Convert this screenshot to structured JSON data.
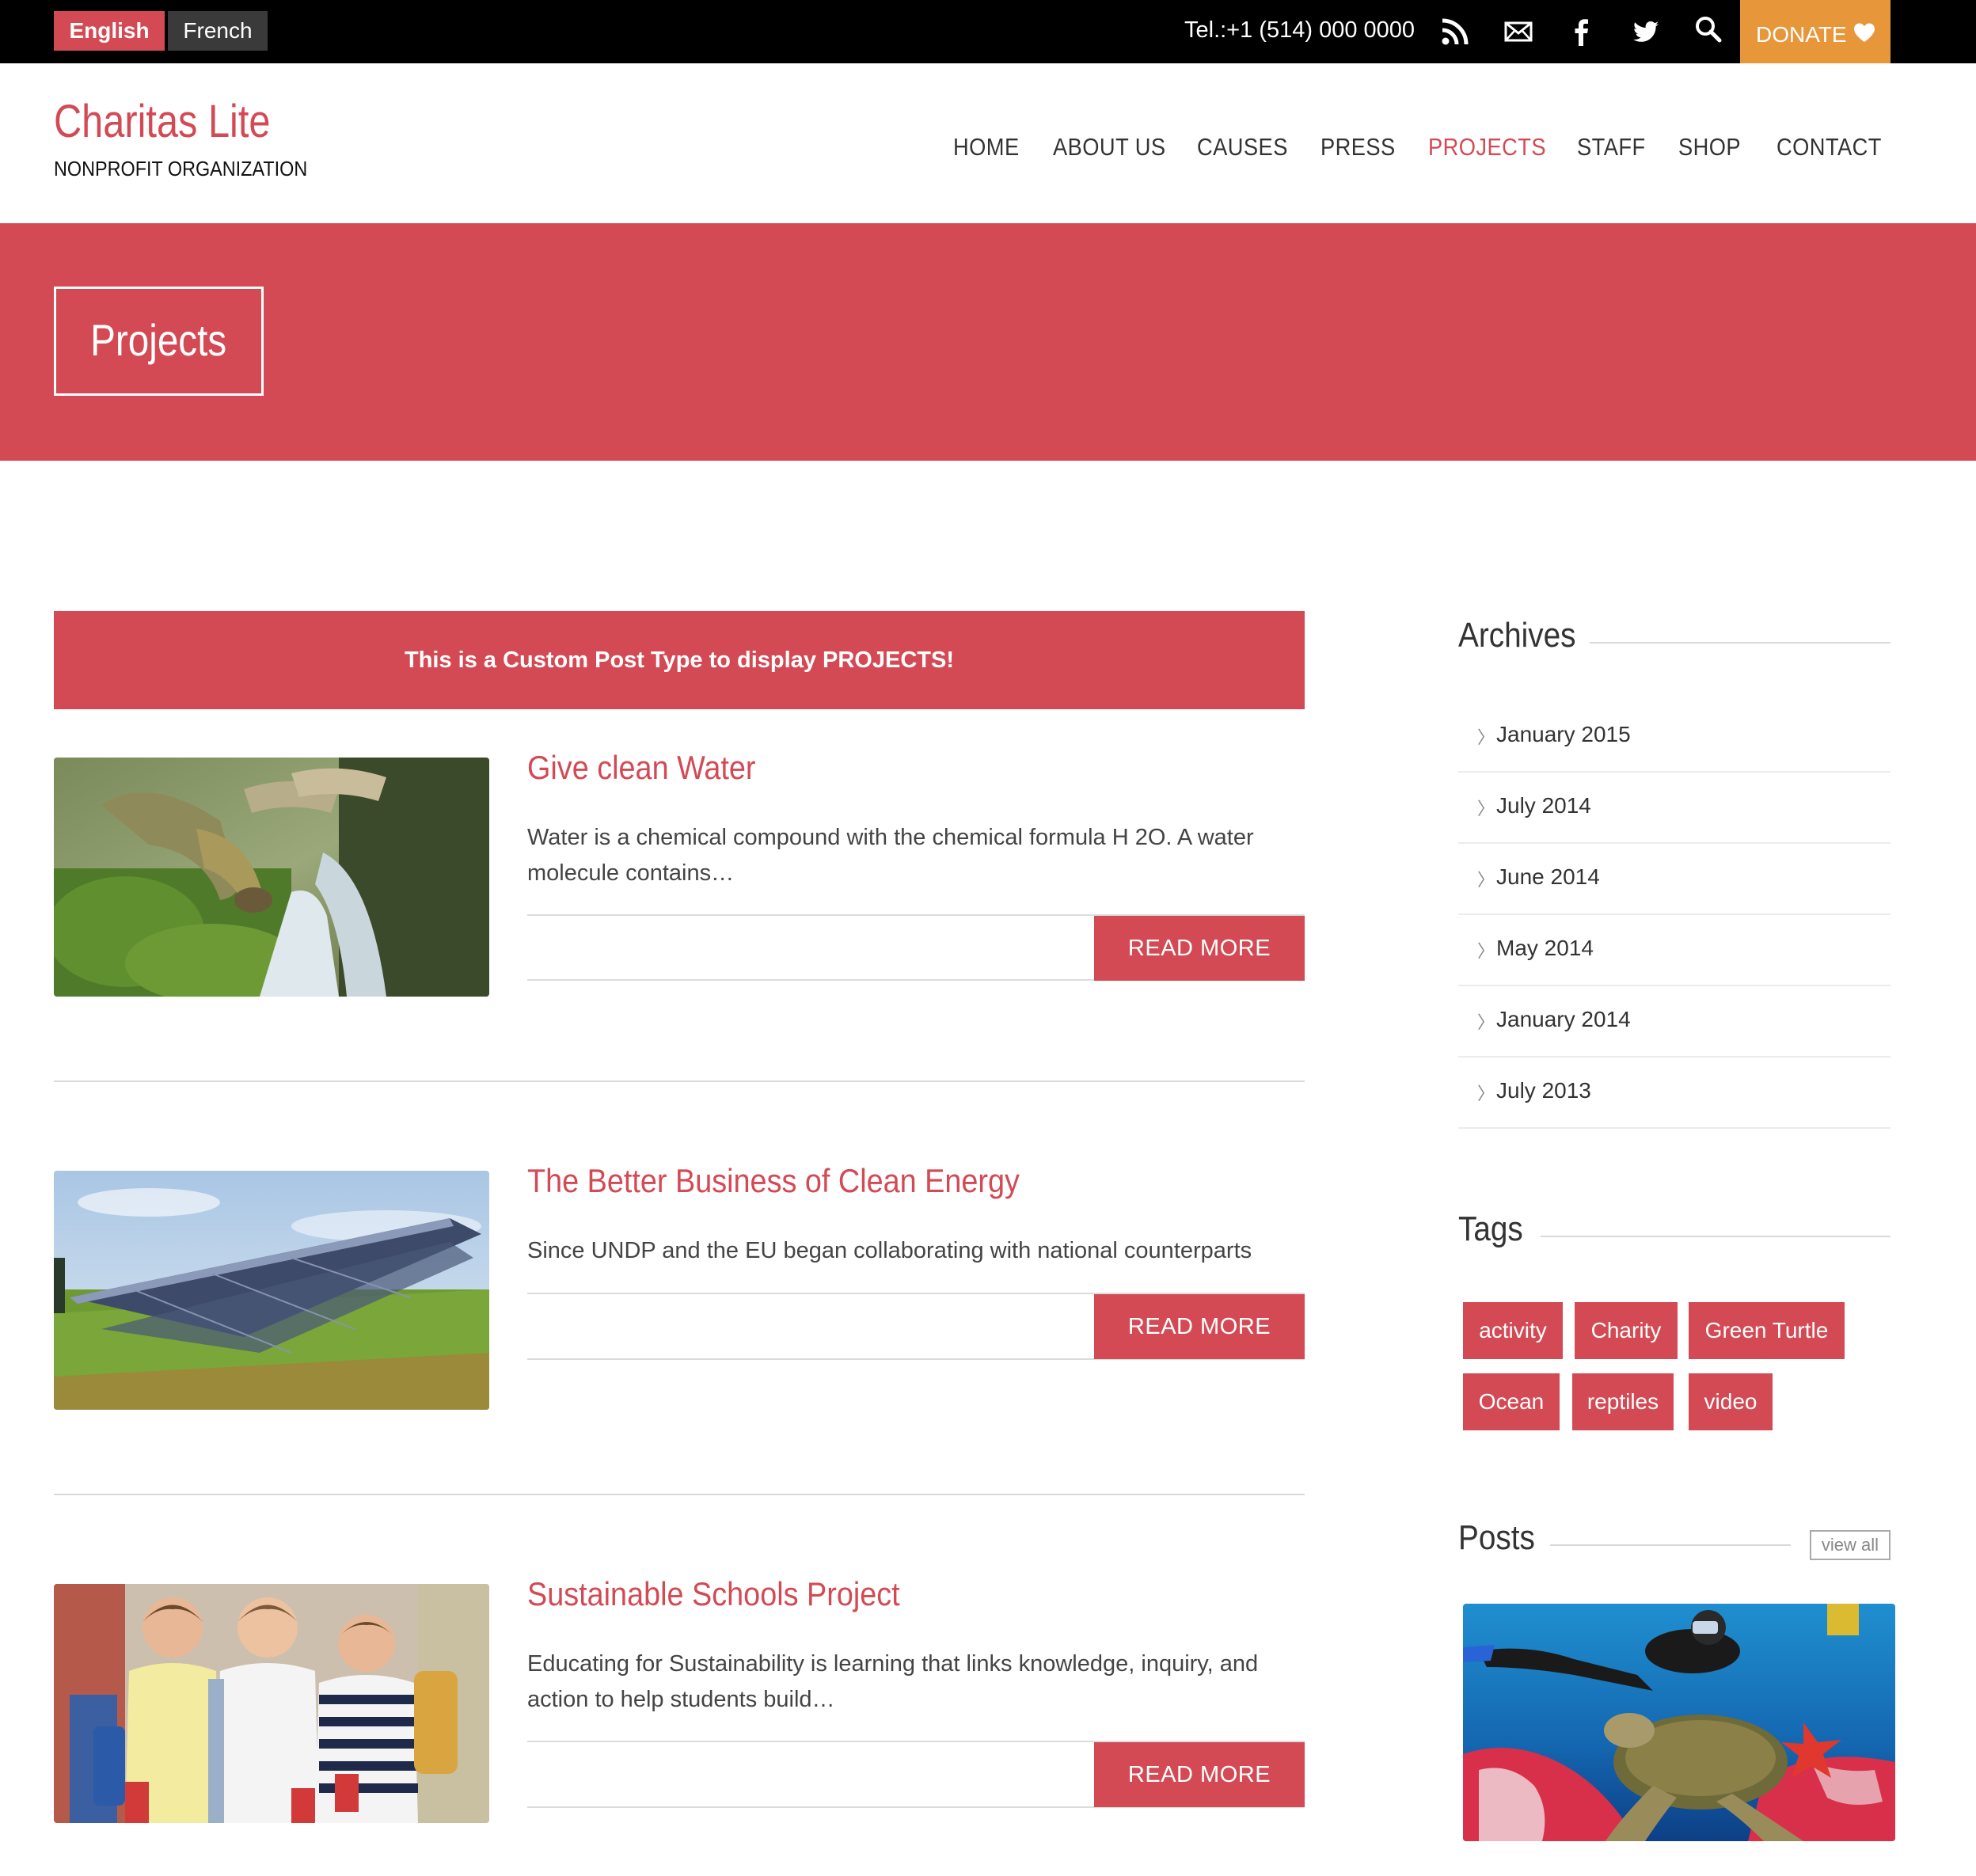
{
  "topbar": {
    "languages": [
      {
        "label": "English",
        "active": true
      },
      {
        "label": "French",
        "active": false
      }
    ],
    "phone": "Tel.:+1 (514) 000 0000",
    "icons": [
      "rss-icon",
      "mail-icon",
      "facebook-icon",
      "twitter-icon",
      "search-icon"
    ],
    "donate_label": "DONATE",
    "donate_icon": "heart-icon"
  },
  "header": {
    "brand": "Charitas Lite",
    "tagline": "NONPROFIT ORGANIZATION"
  },
  "nav": {
    "items": [
      {
        "label": "HOME"
      },
      {
        "label": "ABOUT US"
      },
      {
        "label": "CAUSES"
      },
      {
        "label": "PRESS"
      },
      {
        "label": "PROJECTS",
        "active": true
      },
      {
        "label": "STAFF"
      },
      {
        "label": "SHOP"
      },
      {
        "label": "CONTACT"
      }
    ]
  },
  "hero": {
    "title": "Projects"
  },
  "notice": "This is a Custom Post Type to display PROJECTS!",
  "posts": [
    {
      "title": "Give clean Water",
      "excerpt": "Water is a chemical compound with the chemical formula H 2O. A water molecule contains…",
      "button": "READ MORE",
      "image": "water-tap-image"
    },
    {
      "title": "The Better Business of Clean Energy",
      "excerpt": "Since UNDP and the EU began collaborating with national counterparts",
      "button": "READ MORE",
      "image": "solar-panels-image"
    },
    {
      "title": "Sustainable Schools Project",
      "excerpt": "Educating for Sustainability is learning that links knowledge, inquiry, and action to help students build…",
      "button": "READ MORE",
      "image": "schoolboys-image"
    }
  ],
  "sidebar": {
    "archives_title": "Archives",
    "archives": [
      "January 2015",
      "July 2014",
      "June 2014",
      "May 2014",
      "January 2014",
      "July 2013"
    ],
    "tags_title": "Tags",
    "tags": [
      "activity",
      "Charity",
      "Green Turtle",
      "Ocean",
      "reptiles",
      "video"
    ],
    "posts_title": "Posts",
    "view_all": "view all",
    "post_image": "diver-turtle-image"
  },
  "colors": {
    "accent": "#d34a55",
    "donate": "#e8963a",
    "topbar": "#000000",
    "french_button": "#3a3a3a"
  }
}
